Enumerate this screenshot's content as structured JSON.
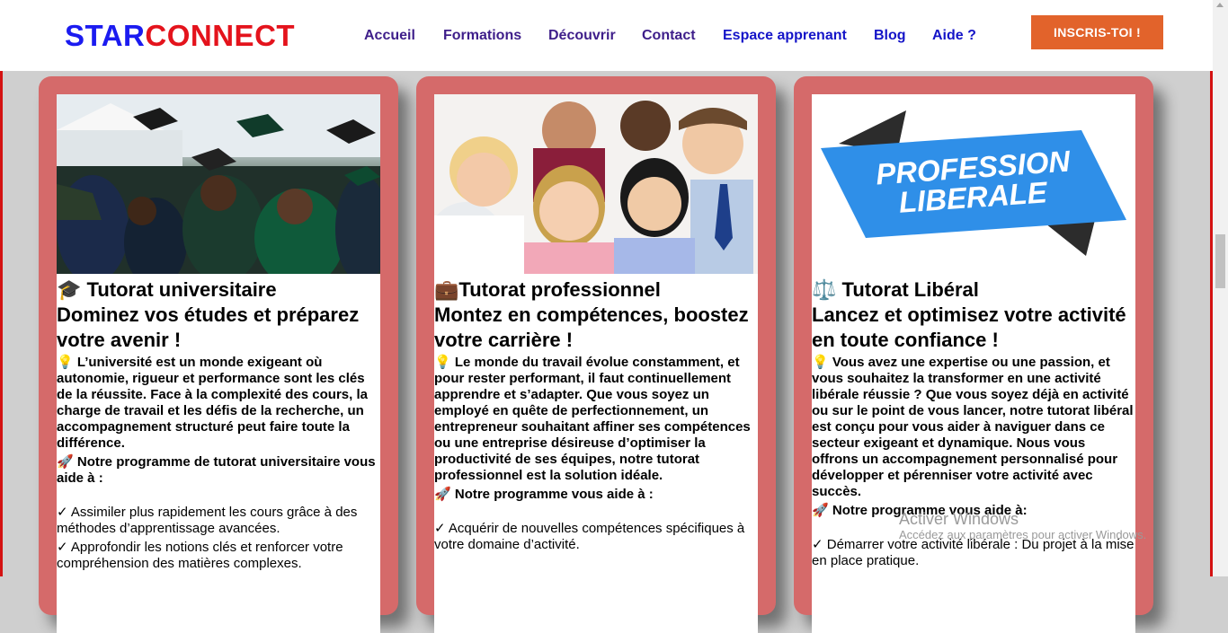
{
  "header": {
    "logo_star": "STAR",
    "logo_connect": "CONNECT",
    "nav": [
      {
        "label": "Accueil",
        "color": "#3e1e8a"
      },
      {
        "label": "Formations",
        "color": "#3e1e8a"
      },
      {
        "label": "Découvrir",
        "color": "#3e1e8a"
      },
      {
        "label": "Contact",
        "color": "#3e1e8a"
      },
      {
        "label": "Espace apprenant",
        "color": "#1414c8"
      },
      {
        "label": "Blog",
        "color": "#1414c8"
      },
      {
        "label": "Aide ?",
        "color": "#1414c8"
      }
    ],
    "cta": "INSCRIS-TOI !"
  },
  "colors": {
    "accent_orange": "#e2632b",
    "card_border": "#d56a6a",
    "brand_blue": "#1b1bf0",
    "brand_red": "#e4131c"
  },
  "cards": [
    {
      "icon": "graduation-cap-icon",
      "emoji": "🎓",
      "title": " Tutorat universitaire",
      "subtitle": "Dominez vos études et préparez votre avenir !",
      "desc_emoji": "💡",
      "description": " L’université est un monde exigeant où autonomie, rigueur et performance sont les clés de la réussite. Face à la complexité des cours, la charge de travail et les défis de la recherche, un accompagnement structuré peut faire toute la différence.",
      "program_emoji": "🚀",
      "program": " Notre programme de tutorat universitaire vous aide à :",
      "items": [
        "✓ Assimiler plus rapidement les cours grâce à des méthodes d’apprentissage avancées.",
        "✓ Approfondir les notions clés et renforcer votre compréhension des matières complexes."
      ]
    },
    {
      "icon": "briefcase-icon",
      "emoji": "💼",
      "title": "Tutorat professionnel",
      "subtitle": "Montez en compétences, boostez votre carrière !",
      "desc_emoji": "💡",
      "description": " Le monde du travail évolue constamment, et pour rester performant, il faut continuellement apprendre et s’adapter. Que vous soyez un employé en quête de perfectionnement, un entrepreneur souhaitant affiner ses compétences ou une entreprise désireuse d’optimiser la productivité de ses équipes, notre tutorat professionnel est la solution idéale.",
      "program_emoji": "🚀",
      "program": " Notre programme vous aide à :",
      "items": [
        "✓ Acquérir de nouvelles compétences spécifiques à votre domaine d’activité."
      ]
    },
    {
      "icon": "scales-icon",
      "emoji": "⚖️",
      "title": " Tutorat Libéral",
      "subtitle": "Lancez et optimisez votre activité en toute confiance !",
      "desc_emoji": "💡",
      "description": " Vous avez une expertise ou une passion, et vous souhaitez la transformer en une activité libérale réussie ? Que vous soyez déjà en activité ou sur le point de vous lancer, notre tutorat libéral est conçu pour vous aider à naviguer dans ce secteur exigeant et dynamique. Nous vous offrons un accompagnement personnalisé pour développer et pérenniser votre activité avec succès.",
      "program_emoji": "🚀",
      "program": " Notre programme vous aide à:",
      "items": [
        "✓ Démarrer votre activité libérale : Du projet à la mise en place pratique."
      ],
      "banner_line1": "PROFESSION",
      "banner_line2": "LIBERALE"
    }
  ],
  "watermark": {
    "title": "Activer Windows",
    "subtitle": "Accédez aux paramètres pour activer Windows."
  }
}
